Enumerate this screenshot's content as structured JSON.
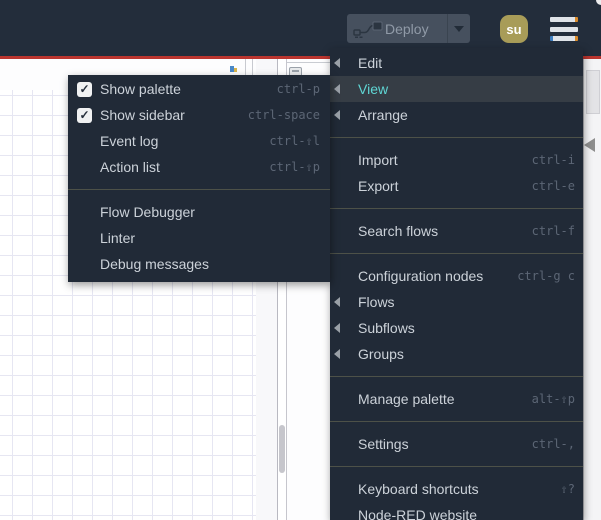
{
  "header": {
    "deploy_label": "Deploy",
    "avatar_initials": "su"
  },
  "main_menu": {
    "sections": [
      {
        "items": [
          {
            "label": "Edit",
            "submenu": true
          },
          {
            "label": "View",
            "submenu": true,
            "active": true
          },
          {
            "label": "Arrange",
            "submenu": true
          }
        ]
      },
      {
        "items": [
          {
            "label": "Import",
            "shortcut": "ctrl-i"
          },
          {
            "label": "Export",
            "shortcut": "ctrl-e"
          }
        ]
      },
      {
        "items": [
          {
            "label": "Search flows",
            "shortcut": "ctrl-f"
          }
        ]
      },
      {
        "items": [
          {
            "label": "Configuration nodes",
            "shortcut": "ctrl-g c"
          },
          {
            "label": "Flows",
            "submenu": true
          },
          {
            "label": "Subflows",
            "submenu": true
          },
          {
            "label": "Groups",
            "submenu": true
          }
        ]
      },
      {
        "items": [
          {
            "label": "Manage palette",
            "shortcut": "alt-⇧p"
          }
        ]
      },
      {
        "items": [
          {
            "label": "Settings",
            "shortcut": "ctrl-,"
          }
        ]
      },
      {
        "items": [
          {
            "label": "Keyboard shortcuts",
            "shortcut": "⇧?"
          },
          {
            "label": "Node-RED website"
          }
        ]
      }
    ]
  },
  "view_submenu": {
    "sections": [
      {
        "items": [
          {
            "label": "Show palette",
            "shortcut": "ctrl-p",
            "checked": true
          },
          {
            "label": "Show sidebar",
            "shortcut": "ctrl-space",
            "checked": true
          },
          {
            "label": "Event log",
            "shortcut": "ctrl-⇧l"
          },
          {
            "label": "Action list",
            "shortcut": "ctrl-⇧p"
          }
        ]
      },
      {
        "items": [
          {
            "label": "Flow Debugger"
          },
          {
            "label": "Linter"
          },
          {
            "label": "Debug messages"
          }
        ]
      }
    ]
  },
  "icons": {
    "hamburger": "menu-icon",
    "deploy_node": "deploy-node-icon",
    "deploy_caret": "chevron-down-icon",
    "submenu_arrow": "chevron-left-icon",
    "checkbox_check": "✓",
    "sidebar_toggle": "triangle-left-icon"
  },
  "colors": {
    "header_bg": "#232d3b",
    "header_rule": "#bb352f",
    "menu_bg": "#212a37",
    "menu_text": "#ccd2d9",
    "menu_active_bg": "#363d45",
    "menu_active_text": "#5fd6d4",
    "shortcut_text": "#5c6675",
    "separator": "#4d5148",
    "avatar_bg": "#a89c58",
    "grid_line": "#e6e6f2"
  }
}
